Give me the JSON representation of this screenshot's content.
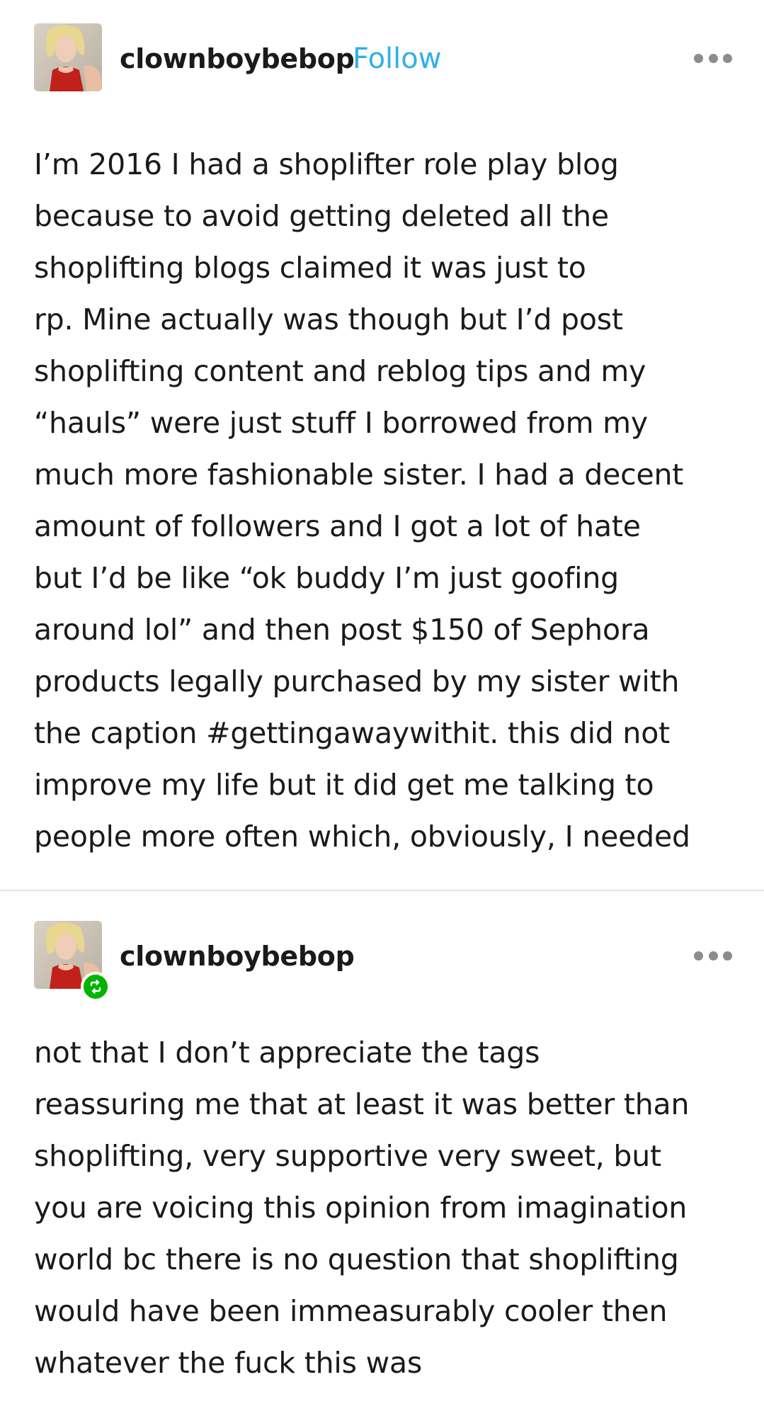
{
  "posts": [
    {
      "username": "clownboybebop",
      "follow_label": "Follow",
      "avatar_icon": "user-avatar",
      "more_icon": "ellipsis-icon",
      "lines": [
        "I’m 2016 I had a shoplifter role play blog",
        "because to avoid getting deleted all the",
        "shoplifting blogs claimed it was just to",
        "rp. Mine actually was though but I’d post",
        "shoplifting content and reblog tips and my",
        "“hauls” were just stuff I borrowed from my",
        "much more fashionable sister. I had a decent",
        "amount of followers and I got a lot of hate",
        "but I’d be like “ok buddy I’m just goofing",
        "around lol” and then post $150 of Sephora",
        "products legally purchased by my sister with",
        "the caption #gettingawaywithit. this did not",
        "improve my life but it did get me talking to",
        "people more often which, obviously, I needed"
      ]
    },
    {
      "username": "clownboybebop",
      "avatar_icon": "user-avatar",
      "badge_icon": "reblog-icon",
      "more_icon": "ellipsis-icon",
      "lines": [
        "not that I don’t appreciate the tags",
        "reassuring me that at least it was better than",
        "shoplifting, very supportive very sweet, but",
        "you are voicing this opinion from imagination",
        "world bc there is no question that shoplifting",
        "would have been immeasurably cooler then",
        "whatever the fuck this was"
      ]
    }
  ],
  "colors": {
    "follow": "#2fb0e6",
    "reblog_badge": "#00b400",
    "text": "#1a1a1a",
    "divider": "#e4e4e4"
  }
}
